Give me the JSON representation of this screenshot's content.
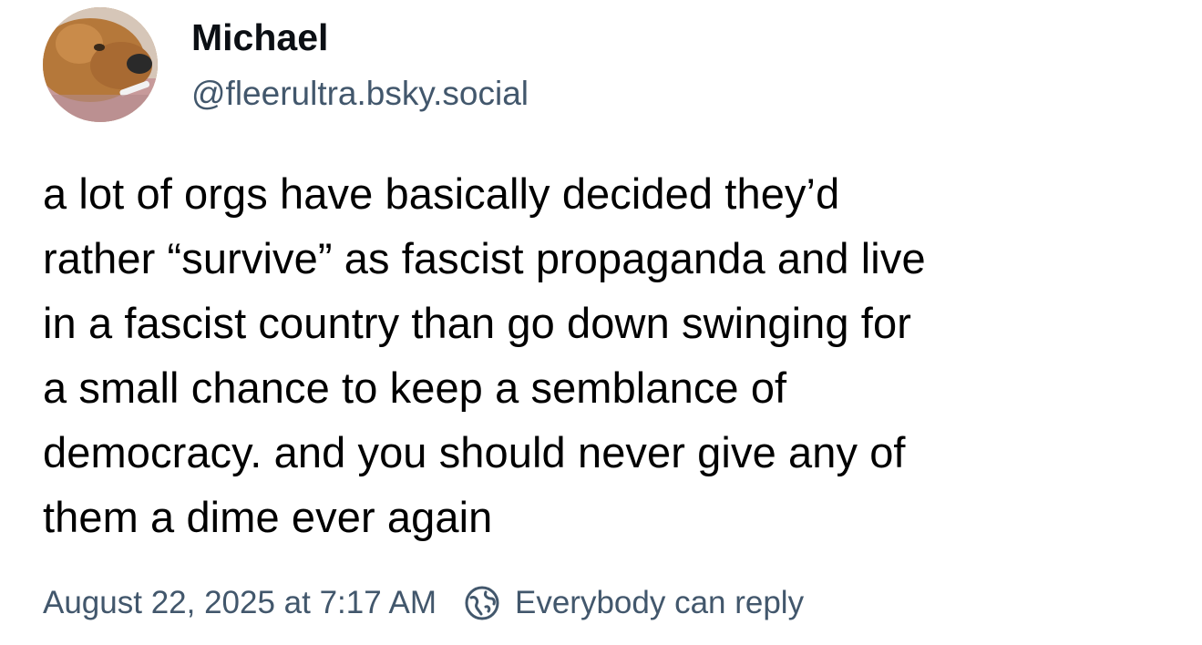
{
  "post": {
    "author": {
      "display_name": "Michael",
      "handle": "@fleerultra.bsky.social",
      "avatar_icon": "avatar-dog-photo"
    },
    "text": "a lot of orgs have basically decided they’d\nrather “survive” as fascist propaganda and live\nin a fascist country than go down swinging for\na small chance to keep a semblance of\ndemocracy. and you should never give any of\nthem a dime ever again",
    "timestamp": "August 22, 2025 at 7:17 AM",
    "reply_setting": {
      "icon": "globe-icon",
      "label": "Everybody can reply"
    }
  },
  "colors": {
    "text_primary": "#000000",
    "text_secondary": "#42576c"
  }
}
